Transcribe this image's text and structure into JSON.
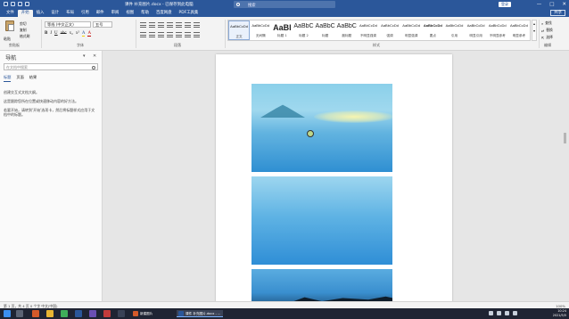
{
  "titlebar": {
    "doc_title": "课件 补充图片.docx - 已保存到此电脑",
    "search_placeholder": "搜索",
    "login_label": "登录",
    "minimize": "—",
    "maximize": "□",
    "close": "✕"
  },
  "tabs": [
    "文件",
    "开始",
    "插入",
    "设计",
    "布局",
    "引用",
    "邮件",
    "审阅",
    "视图",
    "帮助",
    "百度网盘",
    "PDF工具集"
  ],
  "share_label": "共享",
  "ribbon": {
    "paste_label": "粘贴",
    "cut_label": "剪切",
    "copy_label": "复制",
    "format_painter_label": "格式刷",
    "font_name": "等线 (中文正文)",
    "font_size": "五号",
    "font_row_labels": [
      "B",
      "I",
      "U",
      "abc",
      "x₂",
      "x²",
      "A",
      "A"
    ],
    "groups": {
      "clipboard": "剪贴板",
      "font": "字体",
      "paragraph": "段落",
      "styles": "样式",
      "editing": "编辑"
    },
    "styles": [
      {
        "sample": "AaBbCcDd",
        "name": "正文",
        "size": "4px",
        "active": true
      },
      {
        "sample": "AaBbCcDd",
        "name": "无间隔",
        "size": "4px"
      },
      {
        "sample": "AaBl",
        "name": "标题 1",
        "size": "9px",
        "bold": true
      },
      {
        "sample": "AaBbC",
        "name": "标题 2",
        "size": "7px"
      },
      {
        "sample": "AaBbC",
        "name": "标题",
        "size": "7px"
      },
      {
        "sample": "AaBbC",
        "name": "副标题",
        "size": "7px"
      },
      {
        "sample": "AaBbCcDd",
        "name": "不明显强调",
        "size": "4px"
      },
      {
        "sample": "AaBbCcDd",
        "name": "强调",
        "size": "4px"
      },
      {
        "sample": "AaBbCcDd",
        "name": "明显强调",
        "size": "4px"
      },
      {
        "sample": "AaBbCcDd",
        "name": "要点",
        "size": "4px",
        "bold": true
      },
      {
        "sample": "AaBbCcDd",
        "name": "引用",
        "size": "4px"
      },
      {
        "sample": "AaBbCcDd",
        "name": "明显引用",
        "size": "4px"
      },
      {
        "sample": "AaBbCcDd",
        "name": "不明显参考",
        "size": "4px"
      },
      {
        "sample": "AaBbCcDd",
        "name": "明显参考",
        "size": "4px"
      }
    ],
    "editing": {
      "find": "查找",
      "replace": "替换",
      "select": "选择"
    }
  },
  "nav": {
    "title": "导航",
    "search_placeholder": "在文档中搜索",
    "tabs": [
      "标题",
      "页面",
      "结果"
    ],
    "messages": [
      "创建交互式文档大纲。",
      "这是跟踪您所在位置或快速移动内容的好方法。",
      "若要开始，请转到'开始'选项卡，然后将标题样式应用于文档中的标题。"
    ]
  },
  "statusbar": {
    "left": "第 1 页，共 4 页    0 个字    中文(中国)",
    "right": "100%"
  },
  "taskbar": {
    "apps": [
      {
        "label": "新建图片",
        "active": false
      },
      {
        "label": "课件 补充图片.docx - ...",
        "active": true
      }
    ],
    "time": "10:24",
    "date": "2021/5/5"
  },
  "colors": {
    "accent": "#2b579a",
    "ribbon_bg": "#f3f3f3",
    "doc_bg": "#e6e6e6"
  }
}
